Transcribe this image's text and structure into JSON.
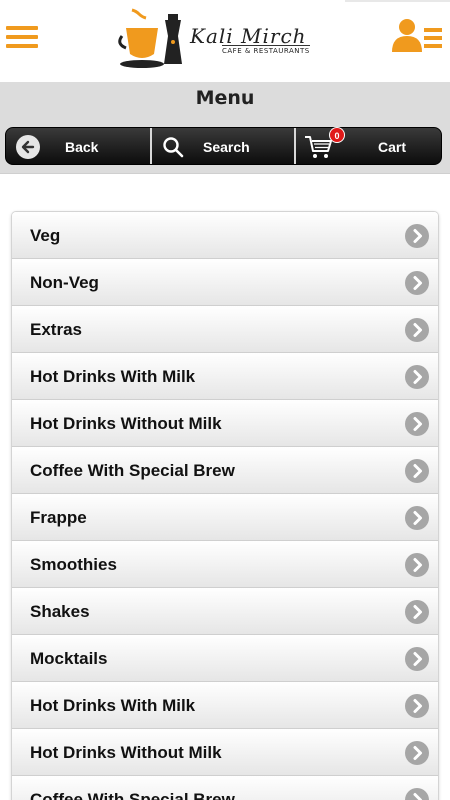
{
  "header": {
    "logo_title": "Kali Mirch",
    "logo_subtitle": "CAFE & RESTAURANTS"
  },
  "page": {
    "title": "Menu"
  },
  "nav": {
    "back_label": "Back",
    "search_label": "Search",
    "cart_label": "Cart",
    "cart_count": "0"
  },
  "colors": {
    "accent": "#f09a1e",
    "badge": "#e01919",
    "navbar": "#1a1a1a"
  },
  "menu": {
    "items": [
      {
        "label": "Veg"
      },
      {
        "label": "Non-Veg"
      },
      {
        "label": "Extras"
      },
      {
        "label": "Hot Drinks With Milk"
      },
      {
        "label": "Hot Drinks Without Milk"
      },
      {
        "label": "Coffee With Special Brew"
      },
      {
        "label": "Frappe"
      },
      {
        "label": "Smoothies"
      },
      {
        "label": "Shakes"
      },
      {
        "label": "Mocktails"
      },
      {
        "label": "Hot Drinks With Milk"
      },
      {
        "label": "Hot Drinks Without Milk"
      },
      {
        "label": "Coffee With Special Brew"
      }
    ]
  }
}
